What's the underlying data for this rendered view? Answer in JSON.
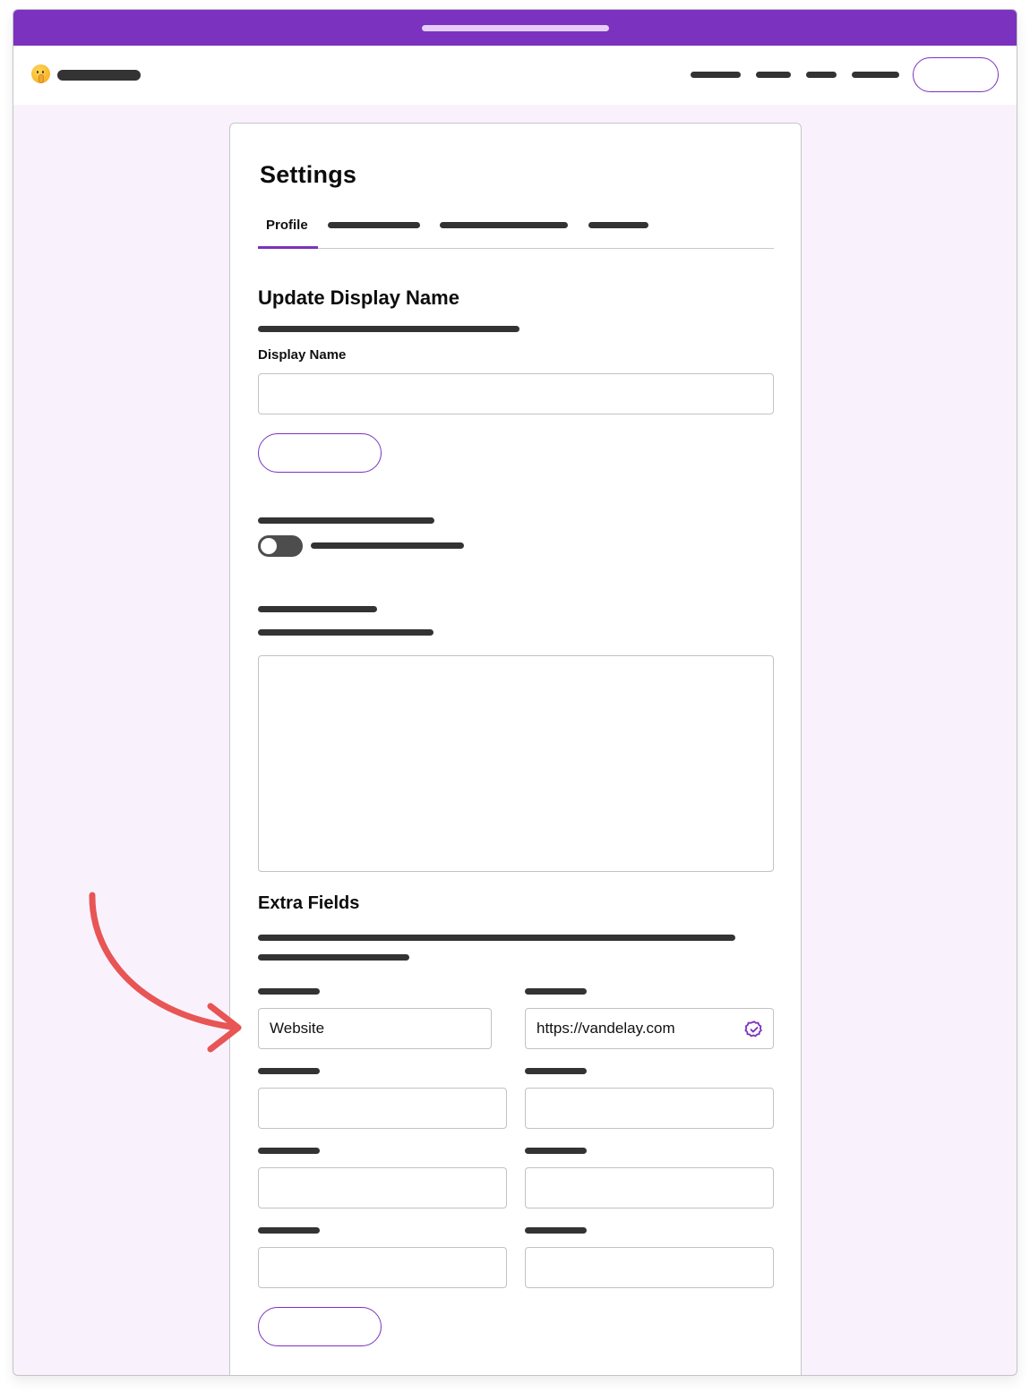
{
  "browser": {
    "address_bar": ""
  },
  "header": {
    "logo_icon": "shushing-face-emoji",
    "nav_links_count": 4,
    "cta_button_label": ""
  },
  "settings": {
    "title": "Settings",
    "tabs": [
      {
        "label": "Profile",
        "active": true
      },
      {
        "label": "",
        "active": false
      },
      {
        "label": "",
        "active": false
      },
      {
        "label": "",
        "active": false
      }
    ],
    "display_name_section": {
      "title": "Update Display Name",
      "field_label": "Display Name",
      "field_value": "",
      "save_button_label": ""
    },
    "toggle_section": {
      "toggle_on": false
    },
    "bio_section": {
      "textarea_value": ""
    },
    "extra_fields_section": {
      "title": "Extra Fields",
      "fields": [
        {
          "name": "Website",
          "value": "https://vandelay.com",
          "verified": true
        },
        {
          "name": "",
          "value": "",
          "verified": false
        },
        {
          "name": "",
          "value": "",
          "verified": false
        },
        {
          "name": "",
          "value": "",
          "verified": false
        }
      ],
      "save_button_label": ""
    }
  },
  "annotation": {
    "arrow_color": "#e85555",
    "points_to": "extra-field-name-1"
  },
  "colors": {
    "brand": "#7b32bf",
    "page_background": "#f9f2fd",
    "skeleton": "#333333"
  }
}
